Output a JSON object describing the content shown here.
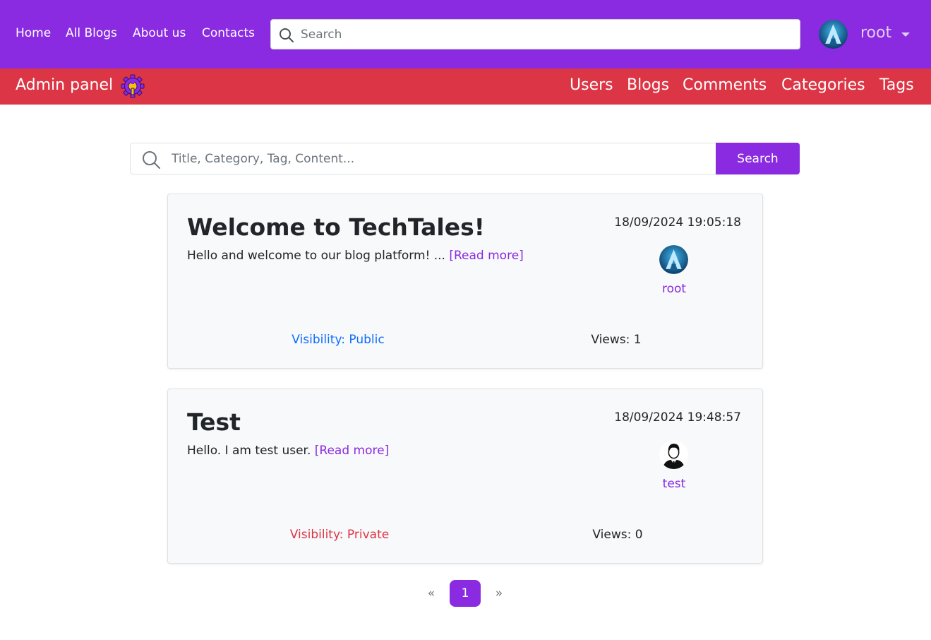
{
  "nav": {
    "links": [
      "Home",
      "All Blogs",
      "About us",
      "Contacts"
    ],
    "search_placeholder": "Search",
    "user": "root"
  },
  "admin": {
    "title": "Admin panel",
    "links": [
      "Users",
      "Blogs",
      "Comments",
      "Categories",
      "Tags"
    ]
  },
  "search": {
    "placeholder": "Title, Category, Tag, Content...",
    "button": "Search"
  },
  "posts": [
    {
      "title": "Welcome to TechTales!",
      "excerpt": "Hello and welcome to our blog platform!  ... ",
      "read_more": "[Read more]",
      "date": "18/09/2024 19:05:18",
      "author": "root",
      "author_icon": "arch-logo-avatar-icon",
      "visibility": "Visibility: Public",
      "visibility_color": "#0d6efd",
      "views": "Views: 1"
    },
    {
      "title": "Test",
      "excerpt": "Hello. I am test user. ",
      "read_more": "[Read more]",
      "date": "18/09/2024 19:48:57",
      "author": "test",
      "author_icon": "businessman-avatar-icon",
      "visibility": "Visibility: Private",
      "visibility_color": "#dc3545",
      "views": "Views: 0"
    }
  ],
  "pagination": {
    "prev": "«",
    "current": "1",
    "next": "»"
  },
  "colors": {
    "brand": "#8a2be2",
    "admin_bar": "#dc3545"
  }
}
